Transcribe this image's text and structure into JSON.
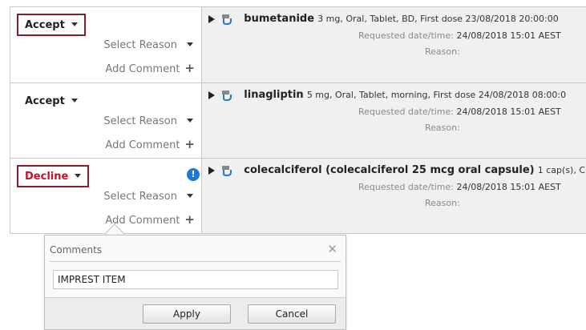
{
  "rows": [
    {
      "decision": "Accept",
      "select_reason": "Select Reason",
      "add_comment": "Add Comment",
      "drug": "bumetanide",
      "dose": "3 mg, Oral, Tablet, BD, First dose 23/08/2018 20:00:00",
      "requested_label": "Requested date/time:",
      "requested_value": "24/08/2018 15:01  AEST",
      "reason_label": "Reason:"
    },
    {
      "decision": "Accept",
      "select_reason": "Select Reason",
      "add_comment": "Add Comment",
      "drug": "linagliptin",
      "dose": "5 mg, Oral, Tablet, morning, First dose 24/08/2018 08:00:0",
      "requested_label": "Requested date/time:",
      "requested_value": "24/08/2018 15:01  AEST",
      "reason_label": "Reason:"
    },
    {
      "decision": "Decline",
      "select_reason": "Select Reason",
      "add_comment": "Add Comment",
      "drug": "colecalciferol (colecalciferol 25 mcg oral capsule)",
      "dose": "1 cap(s), C",
      "requested_label": "Requested date/time:",
      "requested_value": "24/08/2018 15:01  AEST",
      "reason_label": "Reason:"
    }
  ],
  "icons": {
    "info": "info-icon",
    "expand": "triangle-right-icon",
    "medication": "pill-icon",
    "close": "close-icon",
    "add": "plus-icon"
  },
  "colors": {
    "highlight_border": "#8b1a2a",
    "decline_text": "#c8102e",
    "info_blue": "#1f78d6"
  },
  "comments_popup": {
    "title": "Comments",
    "input_value": "IMPREST ITEM",
    "apply_label": "Apply",
    "cancel_label": "Cancel"
  }
}
